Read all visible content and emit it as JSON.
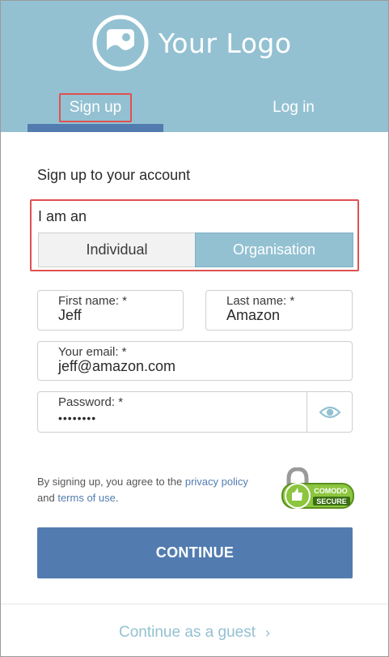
{
  "brand": {
    "logo_text": "Your Logo",
    "header_color": "#93c1d2",
    "accent_color": "#527cb0"
  },
  "tabs": [
    {
      "label": "Sign up",
      "active": true
    },
    {
      "label": "Log in",
      "active": false
    }
  ],
  "form": {
    "title": "Sign up to your account",
    "account_type": {
      "label": "I am an",
      "options": [
        "Individual",
        "Organisation"
      ],
      "selected": "Organisation"
    },
    "first_name": {
      "label": "First name: *",
      "value": "Jeff"
    },
    "last_name": {
      "label": "Last name: *",
      "value": "Amazon"
    },
    "email": {
      "label": "Your email: *",
      "value": "jeff@amazon.com"
    },
    "password": {
      "label": "Password: *",
      "value": "••••••••",
      "toggle_icon": "eye-icon"
    }
  },
  "terms": {
    "prefix": "By signing up, you agree to the",
    "privacy_link": "privacy policy",
    "middle": "and",
    "terms_link": "terms of use",
    "suffix": "."
  },
  "seal": {
    "line1": "COMODO",
    "line2": "SECURE"
  },
  "actions": {
    "continue_label": "CONTINUE",
    "guest_label": "Continue as a guest",
    "guest_icon": "chevron-right-icon"
  }
}
